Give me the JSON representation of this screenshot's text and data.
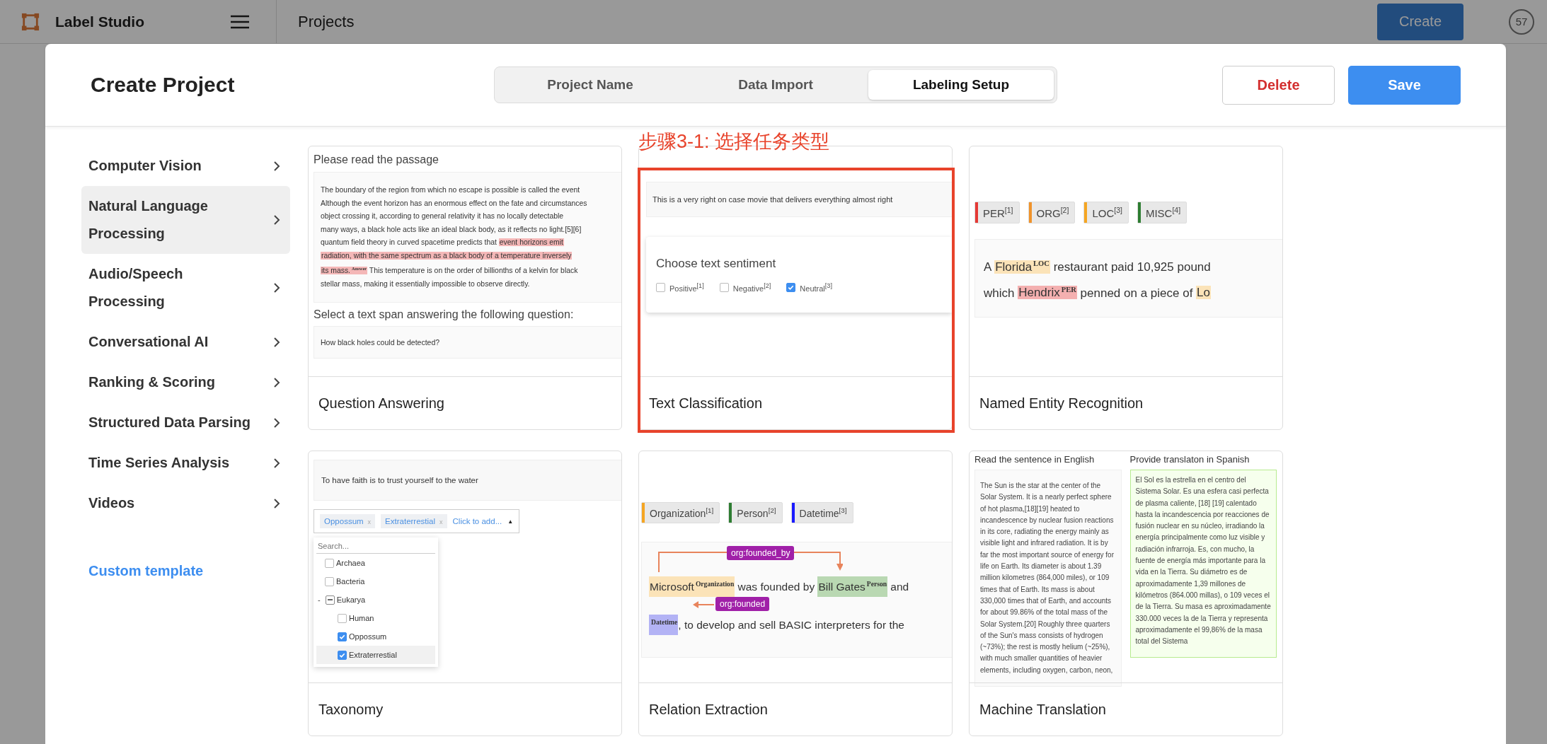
{
  "app_bar": {
    "logo_text": "Label Studio",
    "page_title": "Projects",
    "create_button": "Create",
    "avatar": "57"
  },
  "dialog": {
    "title": "Create Project",
    "steps": [
      {
        "label": "Project Name",
        "selected": false
      },
      {
        "label": "Data Import",
        "selected": false
      },
      {
        "label": "Labeling Setup",
        "selected": true
      }
    ],
    "delete_button": "Delete",
    "save_button": "Save"
  },
  "sidebar": {
    "categories": [
      {
        "label": "Computer Vision",
        "selected": false
      },
      {
        "label": "Natural Language Processing",
        "selected": true
      },
      {
        "label": "Audio/Speech Processing",
        "selected": false
      },
      {
        "label": "Conversational AI",
        "selected": false
      },
      {
        "label": "Ranking & Scoring",
        "selected": false
      },
      {
        "label": "Structured Data Parsing",
        "selected": false
      },
      {
        "label": "Time Series Analysis",
        "selected": false
      },
      {
        "label": "Videos",
        "selected": false
      }
    ],
    "custom_template_link": "Custom template"
  },
  "templates": [
    {
      "kind": "question_answering",
      "title": "Question Answering",
      "highlighted": false,
      "preview": {
        "passage_title": "Please read the passage",
        "passage_lines": [
          [
            {
              "kind": "plain",
              "text": "The boundary of the region from which no escape is possible is called the event"
            }
          ],
          [
            {
              "kind": "plain",
              "text": "Although the event horizon has an enormous effect on the fate and circumstances"
            }
          ],
          [
            {
              "kind": "plain",
              "text": "object crossing it, according to general relativity it has no locally detectable"
            }
          ],
          [
            {
              "kind": "plain",
              "text": "many ways, a black hole acts like an ideal black body, as it reflects no light.[5][6]"
            }
          ],
          [
            {
              "kind": "plain",
              "text": "quantum field theory in curved spacetime predicts that "
            },
            {
              "kind": "span",
              "text": "event horizons emit",
              "color": "#f4b7b7"
            }
          ],
          [
            {
              "kind": "span",
              "text": "radiation, with the same spectrum as a black body of a temperature inversely",
              "color": "#f4b7b7"
            }
          ],
          [
            {
              "kind": "span",
              "text": "its mass.",
              "label": "Answer",
              "color": "#f4b7b7"
            },
            {
              "kind": "plain",
              "text": " This temperature is on the order of billionths of a kelvin for black"
            }
          ],
          [
            {
              "kind": "plain",
              "text": "stellar mass, making it essentially impossible to observe directly."
            }
          ]
        ],
        "question_title": "Select a text span answering the following question:",
        "question": "How black holes could be detected?"
      }
    },
    {
      "kind": "text_classification",
      "title": "Text Classification",
      "highlighted": true,
      "callout": "步骤3-1: 选择任务类型",
      "preview": {
        "text": "This is a very right on case movie that delivers everything almost right",
        "question": "Choose text sentiment",
        "choices": [
          {
            "label": "Positive$^{[1]}$",
            "checked": false
          },
          {
            "label": "Negative$^{[2]}$",
            "checked": false
          },
          {
            "label": "Neutral$^{[3]}$",
            "checked": true
          }
        ]
      }
    },
    {
      "kind": "named_entity_recognition",
      "title": "Named Entity Recognition",
      "highlighted": false,
      "preview": {
        "labels": [
          {
            "text": "PER$^{[1]}$",
            "color": "#e53935"
          },
          {
            "text": "ORG$^{[2]}$",
            "color": "#f0932b"
          },
          {
            "text": "LOC$^{[3]}$",
            "color": "#f5a623"
          },
          {
            "text": "MISC$^{[4]}$",
            "color": "#2e7d32"
          }
        ],
        "lines": [
          [
            {
              "kind": "plain",
              "text": "A "
            },
            {
              "kind": "span",
              "text": "Florida",
              "label": "LOC",
              "color": "#fbe3b8"
            },
            {
              "kind": "plain",
              "text": " restaurant paid 10,925 pound"
            }
          ],
          [
            {
              "kind": "plain",
              "text": "which "
            },
            {
              "kind": "span",
              "text": "Hendrix",
              "label": "PER",
              "color": "#f4b0b0"
            },
            {
              "kind": "plain",
              "text": " penned on a piece of "
            },
            {
              "kind": "span",
              "text": "Lo",
              "color": "#fbe3b8"
            }
          ]
        ]
      }
    },
    {
      "kind": "taxonomy",
      "title": "Taxonomy",
      "highlighted": false,
      "preview": {
        "text": "To have faith is to trust yourself to the water",
        "chips": [
          {
            "text": "Oppossum",
            "remove": "x"
          },
          {
            "text": "Extraterrestial",
            "remove": "x"
          }
        ],
        "add_placeholder": "Click to add...",
        "caret": "▲",
        "search_placeholder": "Search...",
        "tree": [
          {
            "label": "Archaea",
            "checked": false,
            "hovered": false
          },
          {
            "label": "Bacteria",
            "checked": false,
            "hovered": false
          },
          {
            "label": "Eukarya",
            "toggle": "-",
            "indeterminate": true,
            "hovered": false,
            "children": [
              {
                "label": "Human",
                "checked": false,
                "hovered": false
              },
              {
                "label": "Oppossum",
                "checked": true,
                "hovered": false
              },
              {
                "label": "Extraterrestial",
                "checked": true,
                "hovered": true
              }
            ]
          }
        ]
      }
    },
    {
      "kind": "relation_extraction",
      "title": "Relation Extraction",
      "highlighted": false,
      "preview": {
        "labels": [
          {
            "text": "Organization$^{[1]}$",
            "color": "#f5a623"
          },
          {
            "text": "Person$^{[2]}$",
            "color": "#2e7d32"
          },
          {
            "text": "Datetime$^{[3]}$",
            "color": "#1a1aff"
          }
        ],
        "lines": [
          [
            {
              "kind": "span",
              "text": "Microsoft",
              "label": "Organization",
              "color": "#fbe3b8"
            },
            {
              "kind": "plain",
              "text": " was founded by "
            },
            {
              "kind": "span",
              "text": "Bill Gates",
              "label": "Person",
              "color": "#b9d8b2"
            },
            {
              "kind": "plain",
              "text": " and"
            }
          ],
          [
            {
              "kind": "span",
              "label": "Datetime",
              "color": "#b3b3f5"
            },
            {
              "kind": "plain",
              "text": ", to develop and sell BASIC interpreters for the"
            }
          ]
        ],
        "relations": [
          {
            "text": "org:founded_by"
          },
          {
            "text": "org:founded"
          }
        ]
      }
    },
    {
      "kind": "machine_translation",
      "title": "Machine Translation",
      "highlighted": false,
      "preview": {
        "source_title": "Read the sentence in English",
        "target_title": "Provide translaton in Spanish",
        "source_text": "The Sun is the star at the center of the Solar System. It is a nearly perfect sphere of hot plasma,[18][19] heated to incandescence by nuclear fusion reactions in its core, radiating the energy mainly as visible light and infrared radiation. It is by far the most important source of energy for life on Earth. Its diameter is about 1.39 million kilometres (864,000 miles), or 109 times that of Earth. Its mass is about 330,000 times that of Earth, and accounts for about 99.86% of the total mass of the Solar System.[20] Roughly three quarters of the Sun's mass consists of hydrogen (~73%); the rest is mostly helium (~25%), with much smaller quantities of heavier elements, including oxygen, carbon, neon,",
        "target_text": "El Sol es la estrella en el centro del Sistema Solar. Es una esfera casi perfecta de plasma caliente, [18] [19] calentado hasta la incandescencia por reacciones de fusión nuclear en su núcleo, irradiando la energía principalmente como luz visible y radiación infrarroja. Es, con mucho, la fuente de energía más importante para la vida en la Tierra. Su diámetro es de aproximadamente 1,39 millones de kilómetros (864.000 millas), o 109 veces el de la Tierra. Su masa es aproximadamente 330.000 veces la de la Tierra y representa aproximadamente el 99,86% de la masa total del Sistema"
      }
    }
  ]
}
